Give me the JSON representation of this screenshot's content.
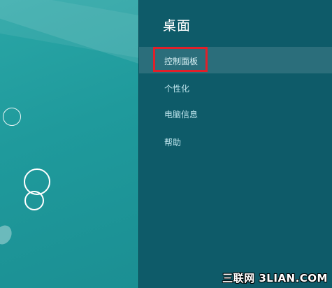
{
  "panel": {
    "title": "桌面",
    "items": [
      {
        "label": "控制面板"
      },
      {
        "label": "个性化"
      },
      {
        "label": "电脑信息"
      },
      {
        "label": "帮助"
      }
    ]
  },
  "watermark": "三联网 3LIAN.COM",
  "colors": {
    "panel_bg": "#0e5b69",
    "desktop_bg": "#1f9a9c",
    "highlight_box": "#e0202a"
  }
}
